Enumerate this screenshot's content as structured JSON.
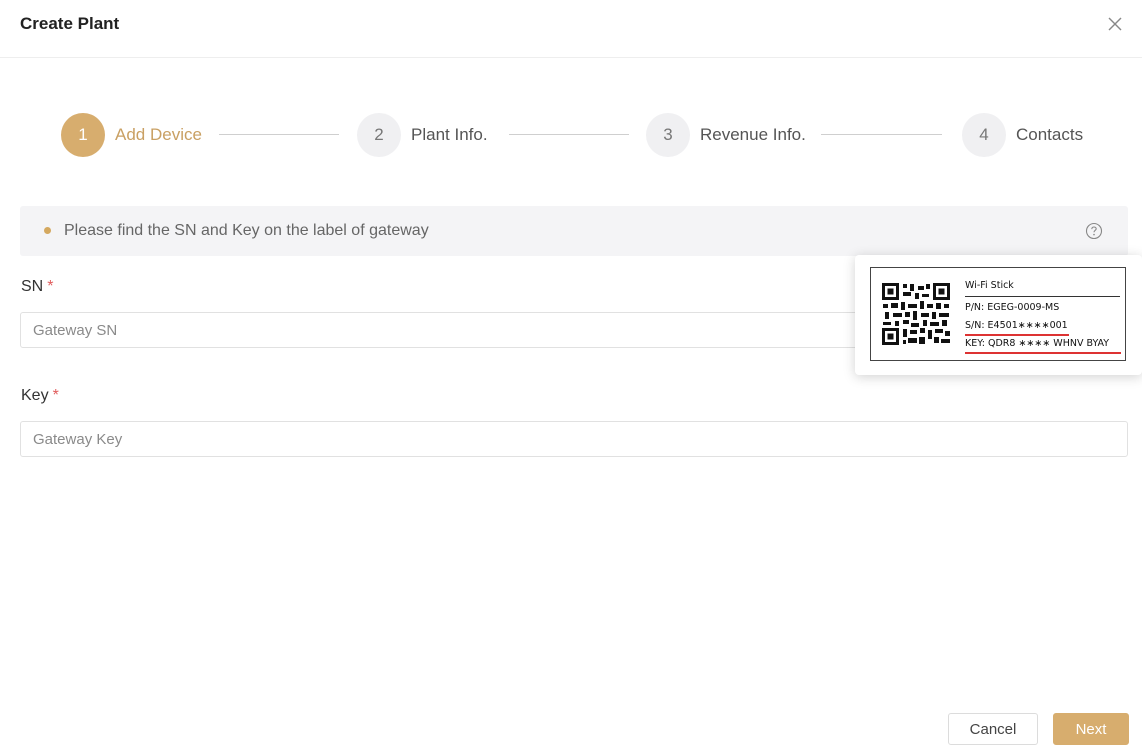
{
  "dialog": {
    "title": "Create Plant"
  },
  "steps": [
    {
      "number": "1",
      "label": "Add Device",
      "active": true
    },
    {
      "number": "2",
      "label": "Plant Info.",
      "active": false
    },
    {
      "number": "3",
      "label": "Revenue Info.",
      "active": false
    },
    {
      "number": "4",
      "label": "Contacts",
      "active": false
    }
  ],
  "hint": {
    "text": "Please find the SN and Key on the label of gateway",
    "icon": "help-circle-icon"
  },
  "form": {
    "sn": {
      "label": "SN",
      "required_mark": "*",
      "placeholder": "Gateway SN",
      "value": ""
    },
    "key": {
      "label": "Key",
      "required_mark": "*",
      "placeholder": "Gateway Key",
      "value": ""
    }
  },
  "label_popover": {
    "product": "Wi-Fi Stick",
    "pn": "P/N:  EGEG-0009-MS",
    "sn": "S/N:  E4501∗∗∗∗001",
    "key": "KEY:  QDR8  ∗∗∗∗  WHNV BYAY"
  },
  "footer": {
    "cancel_label": "Cancel",
    "next_label": "Next"
  },
  "colors": {
    "accent": "#d7ad6e",
    "accent_text": "#c9a063",
    "required": "#e05b5b",
    "hint_bg": "#f4f4f6"
  }
}
